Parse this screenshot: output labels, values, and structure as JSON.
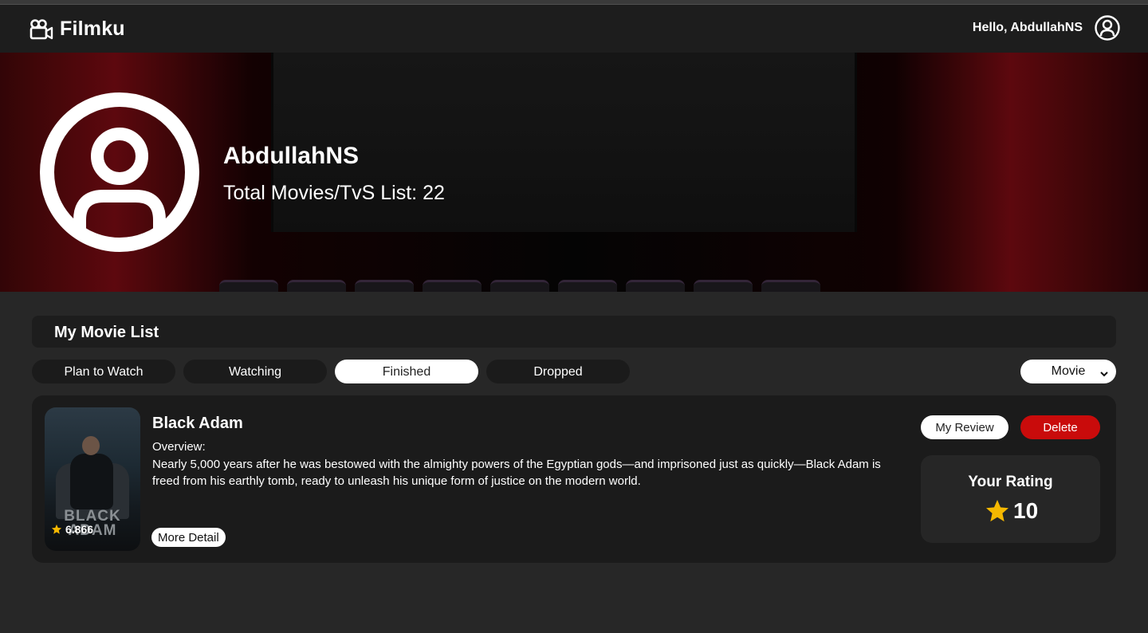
{
  "navbar": {
    "brand": "Filmku",
    "greeting": "Hello, AbdullahNS"
  },
  "profile": {
    "username": "AbdullahNS",
    "total_label": "Total Movies/TvS List: 22"
  },
  "list": {
    "title": "My Movie List",
    "tabs": [
      {
        "label": "Plan to Watch",
        "active": false
      },
      {
        "label": "Watching",
        "active": false
      },
      {
        "label": "Finished",
        "active": true
      },
      {
        "label": "Dropped",
        "active": false
      }
    ],
    "type_select": {
      "selected": "Movie"
    }
  },
  "movie": {
    "title": "Black Adam",
    "poster_text": "BLACK ADAM",
    "tmdb_rating": "6.866",
    "overview_label": "Overview:",
    "overview": "Nearly 5,000 years after he was bestowed with the almighty powers of the Egyptian gods—and imprisoned just as quickly—Black Adam is freed from his earthly tomb, ready to unleash his unique form of justice on the modern world.",
    "more_detail_label": "More Detail",
    "review_label": "My Review",
    "delete_label": "Delete",
    "your_rating_label": "Your Rating",
    "your_rating": "10"
  },
  "colors": {
    "page_bg": "#272727",
    "navbar_bg": "#1d1d1d",
    "card_bg": "#1b1b1b",
    "delete_red": "#c90b0b",
    "star_gold": "#f5b800"
  }
}
